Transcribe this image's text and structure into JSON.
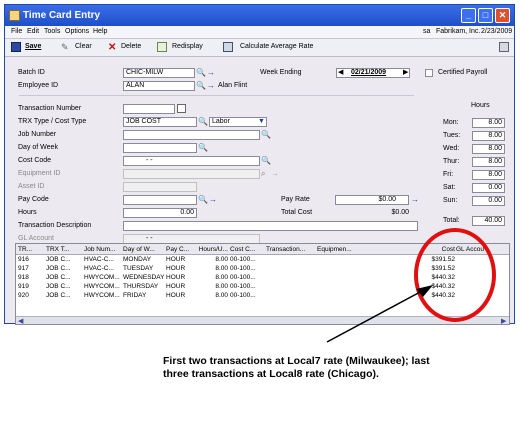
{
  "window": {
    "title": "Time Card Entry"
  },
  "menu": [
    "File",
    "Edit",
    "Tools",
    "Options",
    "Help"
  ],
  "status": {
    "user": "sa",
    "company": "Fabrikam, Inc.",
    "date": "2/23/2009"
  },
  "toolbar": {
    "save": "Save",
    "clear": "Clear",
    "delete": "Delete",
    "redisplay": "Redisplay",
    "calc": "Calculate Average Rate"
  },
  "header": {
    "batch_label": "Batch ID",
    "batch_value": "CHIC-MILW",
    "employee_label": "Employee ID",
    "employee_value": "ALAN",
    "employee_name": "Alan Flint",
    "week_label": "Week Ending",
    "week_value": "02/21/2009",
    "certified_label": "Certified Payroll"
  },
  "form": {
    "trx_number_label": "Transaction Number",
    "trx_type_label": "TRX Type / Cost Type",
    "trx_type_value": "JOB COST",
    "cost_type_value": "Labor",
    "job_number_label": "Job Number",
    "dow_label": "Day of Week",
    "cost_code_label": "Cost Code",
    "cost_code_value": "-          -",
    "equipment_label": "Equipment ID",
    "asset_label": "Asset ID",
    "pay_code_label": "Pay Code",
    "hours_label": "Hours",
    "hours_value": "0.00",
    "trx_desc_label": "Transaction Description",
    "gl_label": "GL Account",
    "gl_value": "-        -",
    "pay_rate_label": "Pay Rate",
    "pay_rate_value": "$0.00",
    "total_cost_label": "Total Cost",
    "total_cost_value": "$0.00"
  },
  "hours_panel": {
    "title": "Hours",
    "days": [
      {
        "d": "Mon:",
        "v": "8.00"
      },
      {
        "d": "Tues:",
        "v": "8.00"
      },
      {
        "d": "Wed:",
        "v": "8.00"
      },
      {
        "d": "Thur:",
        "v": "8.00"
      },
      {
        "d": "Fri:",
        "v": "8.00"
      },
      {
        "d": "Sat:",
        "v": "0.00"
      },
      {
        "d": "Sun:",
        "v": "0.00"
      }
    ],
    "total_label": "Total:",
    "total_value": "40.00"
  },
  "grid": {
    "headers": [
      "TR...",
      "TRX T...",
      "Job Num...",
      "Day of W...",
      "Pay C...",
      "Hours/U...",
      "Cost C...",
      "Transaction...",
      "Equipmen...",
      "Cost",
      "GL Accou"
    ],
    "rows": [
      [
        "916",
        "JOB C...",
        "HVAC-C...",
        "MONDAY",
        "HOUR",
        "8.00",
        "00-100...",
        "",
        "",
        "$391.52",
        ""
      ],
      [
        "917",
        "JOB C...",
        "HVAC-C...",
        "TUESDAY",
        "HOUR",
        "8.00",
        "00-100...",
        "",
        "",
        "$391.52",
        ""
      ],
      [
        "918",
        "JOB C...",
        "HWYCOM...",
        "WEDNESDAY",
        "HOUR",
        "8.00",
        "00-100...",
        "",
        "",
        "$440.32",
        ""
      ],
      [
        "919",
        "JOB C...",
        "HWYCOM...",
        "THURSDAY",
        "HOUR",
        "8.00",
        "00-100...",
        "",
        "",
        "$440.32",
        ""
      ],
      [
        "920",
        "JOB C...",
        "HWYCOM...",
        "FRIDAY",
        "HOUR",
        "8.00",
        "00-100...",
        "",
        "",
        "$440.32",
        ""
      ]
    ]
  },
  "annotation": {
    "text": "First two transactions at Local7 rate (Milwaukee); last three transactions at Local8 rate (Chicago).",
    "color": "#e01010"
  }
}
